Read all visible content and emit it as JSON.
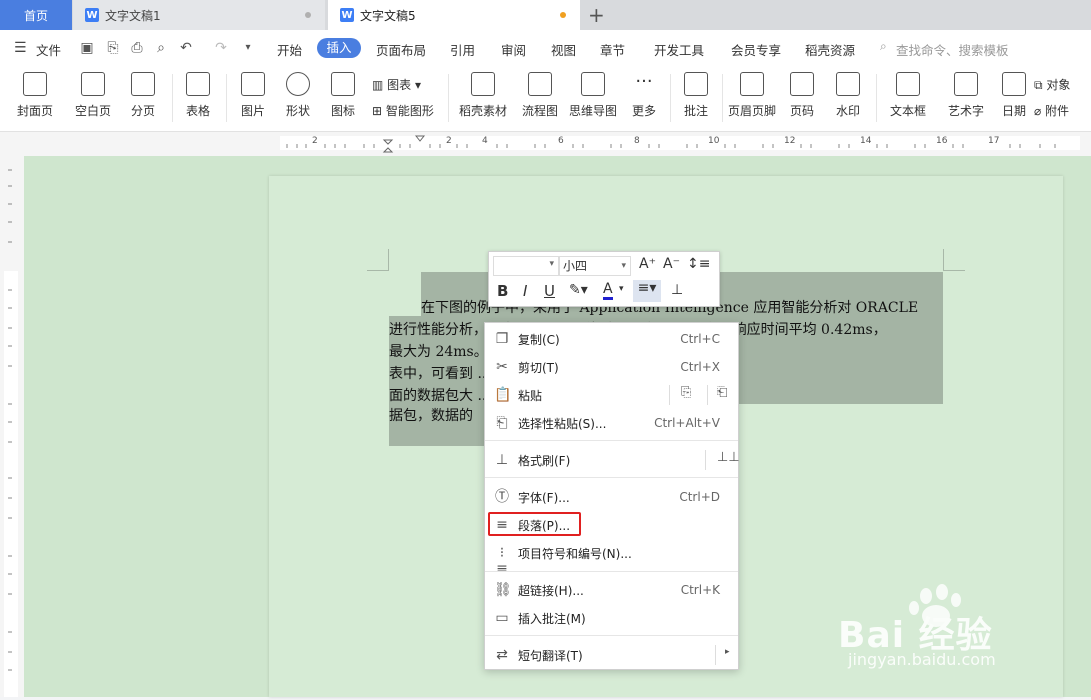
{
  "tabs": {
    "home": "首页",
    "doc1": "文字文稿1",
    "doc5": "文字文稿5"
  },
  "menu": {
    "file": "文件",
    "items": [
      "开始",
      "插入",
      "页面布局",
      "引用",
      "审阅",
      "视图",
      "章节",
      "开发工具",
      "会员专享",
      "稻壳资源"
    ],
    "search_placeholder": "查找命令、搜索模板"
  },
  "ribbon": {
    "cover": "封面页",
    "blank": "空白页",
    "pagebreak": "分页",
    "table": "表格",
    "picture": "图片",
    "shape": "形状",
    "icon": "图标",
    "chart": "图表",
    "smartart": "智能图形",
    "docer": "稻壳素材",
    "flow": "流程图",
    "mindmap": "思维导图",
    "more": "更多",
    "comment": "批注",
    "header": "页眉页脚",
    "pagenum": "页码",
    "watermark": "水印",
    "textbox": "文本框",
    "wordart": "艺术字",
    "date": "日期",
    "object": "对象",
    "attach": "附件"
  },
  "ruler": {
    "marks": [
      "2",
      "2",
      "4",
      "6",
      "8",
      "10",
      "12",
      "14",
      "16",
      "17"
    ]
  },
  "doc": {
    "lines": [
      "在下图的例子中，采用了 Application Intelligence 应用智能分析对 ORACLE",
      "进行性能分析，从中可看到，网络时间平均 0 ... 服务器响应时间平均 0.42ms，",
      "最大为 24ms。 ... 响应）很多，在中间的曲线图",
      "表中，可看到 ... 分有 4280 个 turns。 在最下",
      "面的数据包大 ... 包大部分为小于 255 字节的数",
      "据包，数据的"
    ]
  },
  "mini": {
    "font": "",
    "size": "小四"
  },
  "context_menu": [
    {
      "label": "复制(C)",
      "shortcut": "Ctrl+C",
      "icon": "copy-icon"
    },
    {
      "label": "剪切(T)",
      "shortcut": "Ctrl+X",
      "icon": "cut-icon"
    },
    {
      "label": "粘贴",
      "shortcut": "",
      "icon": "paste-icon"
    },
    {
      "label": "选择性粘贴(S)...",
      "shortcut": "Ctrl+Alt+V",
      "icon": "paste-special-icon"
    },
    {
      "label": "格式刷(F)",
      "shortcut": "",
      "icon": "format-painter-icon"
    },
    {
      "label": "字体(F)...",
      "shortcut": "Ctrl+D",
      "icon": "font-icon"
    },
    {
      "label": "段落(P)...",
      "shortcut": "",
      "icon": "paragraph-icon"
    },
    {
      "label": "项目符号和编号(N)...",
      "shortcut": "",
      "icon": "bullets-icon"
    },
    {
      "label": "超链接(H)...",
      "shortcut": "Ctrl+K",
      "icon": "link-icon"
    },
    {
      "label": "插入批注(M)",
      "shortcut": "",
      "icon": "comment-icon"
    },
    {
      "label": "短句翻译(T)",
      "shortcut": "",
      "icon": "translate-icon"
    }
  ],
  "watermark": {
    "brand": "Bai  经验",
    "url": "jingyan.baidu.com"
  },
  "colors": {
    "accent": "#4a7ee0",
    "highlight": "#e02020",
    "doc_bg": "#cfe6ce"
  }
}
